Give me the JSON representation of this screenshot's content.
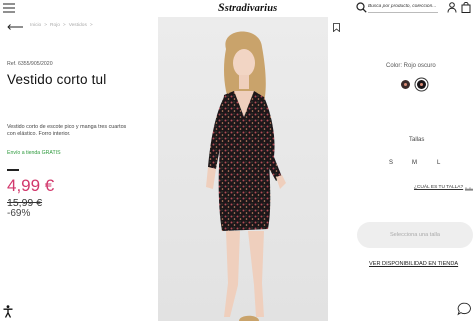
{
  "header": {
    "logo_text": "stradivarius",
    "logo_initial": "S",
    "search_placeholder": "Busca por producto, colección...",
    "icons": [
      "hamburger-icon",
      "search-icon",
      "user-icon",
      "bag-icon"
    ]
  },
  "breadcrumb": {
    "items": [
      "Inicio",
      ">",
      "Rojo",
      ">",
      "Vestidos",
      ">"
    ]
  },
  "product": {
    "ref": "Ref. 6355/905/2020",
    "title": "Vestido corto tul",
    "description": "Vestido corto de escote pico y manga tres cuartos con elástico. Forro interior.",
    "shipping": "Envío a tienda GRATIS",
    "price": "4,99 €",
    "old_price": "15,99 €",
    "discount": "-69%"
  },
  "options": {
    "color_label": "Color: Rojo oscuro",
    "sizes_label": "Tallas",
    "sizes": [
      "S",
      "M",
      "L"
    ],
    "size_guide": "¿CUÁL ES TU TALLA?",
    "select_button": "Selecciona una talla",
    "availability": "VER DISPONIBILIDAD EN TIENDA"
  },
  "colors": {
    "accent_price": "#d2386c",
    "shipping_green": "#2e9a3d",
    "button_bg": "#eeeeee"
  }
}
